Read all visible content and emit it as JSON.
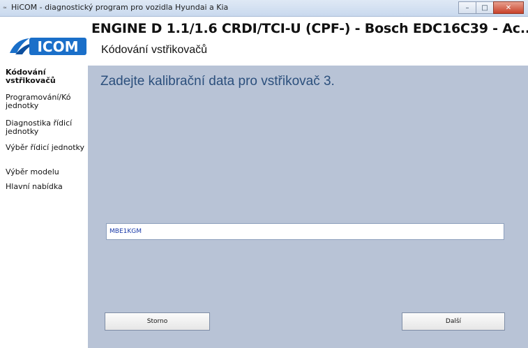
{
  "window": {
    "title": "HiCOM - diagnostický program pro vozidla Hyundai a Kia",
    "buttons": {
      "minimize": "–",
      "maximize": "□",
      "close": "✕"
    }
  },
  "header": {
    "logo_text": "ICOM",
    "title": "ENGINE D 1.1/1.6 CRDI/TCI-U (CPF-) - Bosch EDC16C39 - Ac...",
    "subtitle": "Kódování vstřikovačů"
  },
  "sidebar": {
    "items": [
      {
        "label": "Kódování vstřikovačů",
        "active": true
      },
      {
        "label": "Programování/Kó jednotky",
        "active": false
      },
      {
        "label": "Diagnostika řídicí jednotky",
        "active": false
      },
      {
        "label": "Výběr řídicí jednotky",
        "active": false
      },
      {
        "label": "Výběr modelu",
        "active": false
      },
      {
        "label": "Hlavní nabídka",
        "active": false
      }
    ]
  },
  "main": {
    "prompt": "Zadejte kalibrační data pro vstřikovač 3.",
    "calibration_value": "MBE1KGM",
    "cancel_label": "Storno",
    "next_label": "Další"
  },
  "colors": {
    "panel_bg": "#b8c3d6",
    "prompt_text": "#2b4f7c",
    "input_text": "#1a3aa8",
    "logo_blue": "#1a6fc9"
  }
}
